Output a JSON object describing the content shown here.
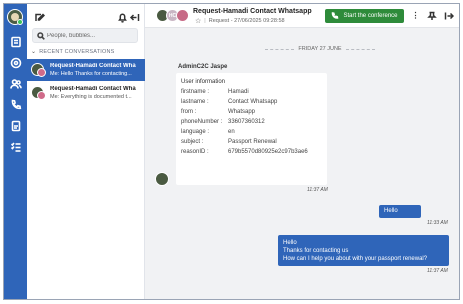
{
  "search": {
    "placeholder": "People, bubbles..."
  },
  "list": {
    "section_label": "RECENT CONVERSATIONS",
    "conversations": [
      {
        "title": "Request-Hamadi Contact Wha",
        "snippet": "Me: Hello Thanks for contacting...",
        "active": true
      },
      {
        "title": "Request-Hamadi Contact Wha",
        "snippet": "Me: Everything is documented t...",
        "active": false
      }
    ]
  },
  "header": {
    "avatar_initials": "HC",
    "title": "Request-Hamadi Contact Whatsapp",
    "subtitle": "Request - 27/06/2025 09:28:58",
    "conference_button": "Start the conference"
  },
  "chat": {
    "date_separator": "FRIDAY 27 JUNE",
    "sender": "AdminC2C Jaspe",
    "card": {
      "heading": "User information",
      "rows": [
        {
          "key": "firstname :",
          "value": "Hamadi"
        },
        {
          "key": "lastname :",
          "value": "Contact Whatsapp"
        },
        {
          "key": "from :",
          "value": "Whatsapp"
        },
        {
          "key": "phoneNumber :",
          "value": "33607360312"
        },
        {
          "key": "language :",
          "value": "en"
        },
        {
          "key": "subject :",
          "value": "Passport Renewal"
        },
        {
          "key": "reasonID :",
          "value": "679b5570d80925e2c97b3ae6"
        }
      ]
    },
    "card_time": "11:37 AM",
    "messages": [
      {
        "text": "Hello",
        "time": "11:33 AM"
      },
      {
        "lines": [
          "Hello",
          "Thanks for contacting us",
          "How can I help you about with your passport renewal?"
        ],
        "time": "11:37 AM"
      }
    ]
  },
  "colors": {
    "rail": "#2f65b9",
    "accent": "#2f65b9",
    "conference": "#2e8b3a",
    "status": "#38c15a"
  }
}
